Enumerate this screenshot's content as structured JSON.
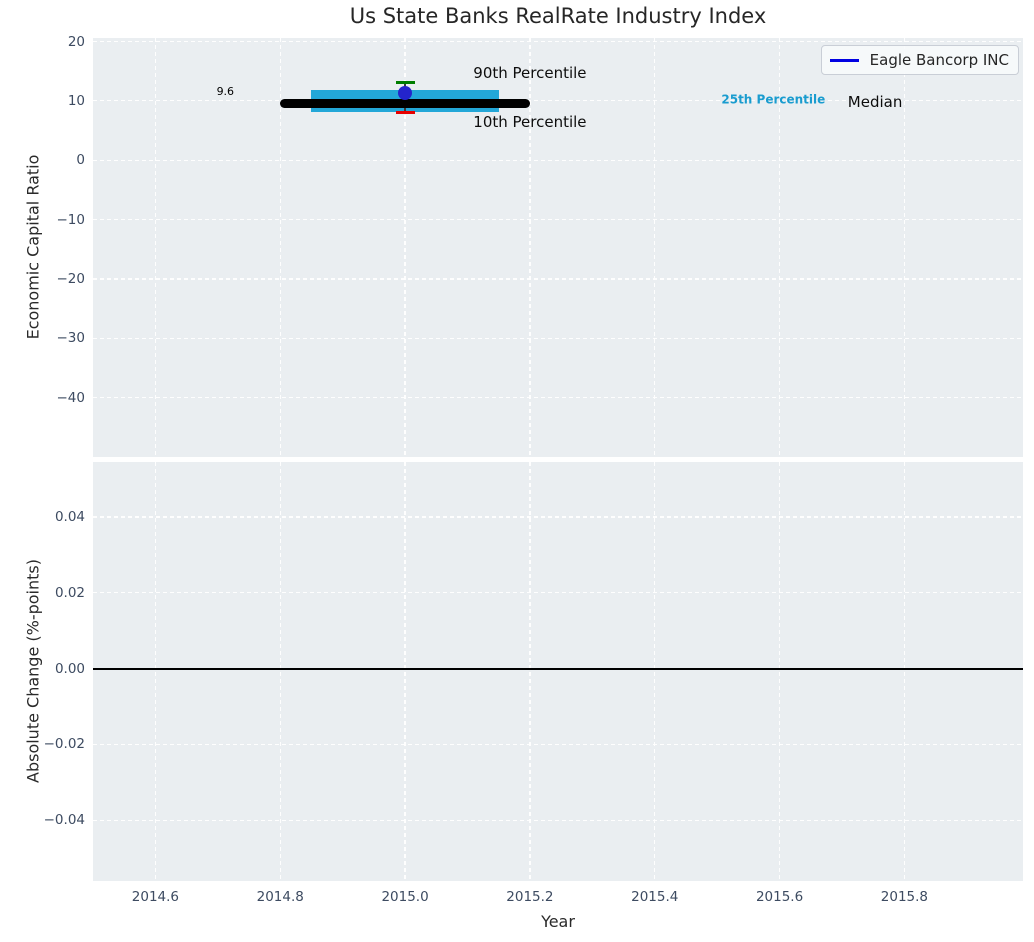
{
  "chart_data": [
    {
      "type": "box",
      "title": "Us State Banks RealRate Industry Index",
      "xlabel": "",
      "ylabel": "Economic Capital Ratio",
      "xlim": [
        2014.5,
        2015.99
      ],
      "ylim": [
        -50,
        20.6
      ],
      "grid": true,
      "xtick_values": [
        2014.6,
        2014.8,
        2015.0,
        2015.2,
        2015.4,
        2015.6,
        2015.8
      ],
      "xtick_labels": [
        "2014.6",
        "2014.8",
        "2015.0",
        "2015.2",
        "2015.4",
        "2015.6",
        "2015.8"
      ],
      "show_xtick_labels": false,
      "ytick_values": [
        20,
        10,
        0,
        -10,
        -20,
        -30,
        -40
      ],
      "ytick_labels": [
        "20",
        "10",
        "0",
        "−10",
        "−20",
        "−30",
        "−40"
      ],
      "legend": {
        "position": "upper right",
        "entries": [
          {
            "label": "Eagle Bancorp INC",
            "color": "#0101e2"
          }
        ]
      },
      "box": {
        "x_center": 2015.0,
        "median": 9.6,
        "median_span": [
          2014.8,
          2015.2
        ],
        "p25": 8.1,
        "p75": 11.9,
        "iqr_span": [
          2014.85,
          2015.15
        ],
        "p10": 8.0,
        "p90": 13.1,
        "colors": {
          "median": "#000000",
          "iqr": "#23a7d8",
          "p90_cap": "#007d00",
          "p10_cap": "#e60000",
          "whisker": "#3a3a3a"
        }
      },
      "company_point": {
        "label": "Eagle Bancorp INC",
        "x": 2015.0,
        "y": 11.3,
        "color": "#2424cc"
      },
      "annotations": [
        {
          "text": "9.6",
          "x": 2014.712,
          "y": 11.5,
          "size": 11,
          "color": "#000000",
          "weight": "normal"
        },
        {
          "text": "90th Percentile",
          "x": 2015.2,
          "y": 14.7,
          "size": 15,
          "color": "#0d0d0d",
          "weight": "normal"
        },
        {
          "text": "10th Percentile",
          "x": 2015.2,
          "y": 6.4,
          "size": 15,
          "color": "#0d0d0d",
          "weight": "normal"
        },
        {
          "text": "25th Percentile",
          "x": 2015.59,
          "y": 10.1,
          "size": 12,
          "color": "#1a9ccf",
          "weight": "bold"
        },
        {
          "text": "Median",
          "x": 2015.753,
          "y": 9.9,
          "size": 15,
          "color": "#0d0d0d",
          "weight": "normal"
        }
      ]
    },
    {
      "type": "line",
      "title": "",
      "xlabel": "Year",
      "ylabel": "Absolute Change (%-points)",
      "xlim": [
        2014.5,
        2015.99
      ],
      "ylim": [
        -0.056,
        0.0545
      ],
      "grid": true,
      "xtick_values": [
        2014.6,
        2014.8,
        2015.0,
        2015.2,
        2015.4,
        2015.6,
        2015.8
      ],
      "xtick_labels": [
        "2014.6",
        "2014.8",
        "2015.0",
        "2015.2",
        "2015.4",
        "2015.6",
        "2015.8"
      ],
      "show_xtick_labels": true,
      "ytick_values": [
        0.04,
        0.02,
        0.0,
        -0.02,
        -0.04
      ],
      "ytick_labels": [
        "0.04",
        "0.02",
        "0.00",
        "−0.02",
        "−0.04"
      ],
      "zero_line": {
        "y": 0.0,
        "color": "#000000"
      },
      "series": []
    }
  ]
}
